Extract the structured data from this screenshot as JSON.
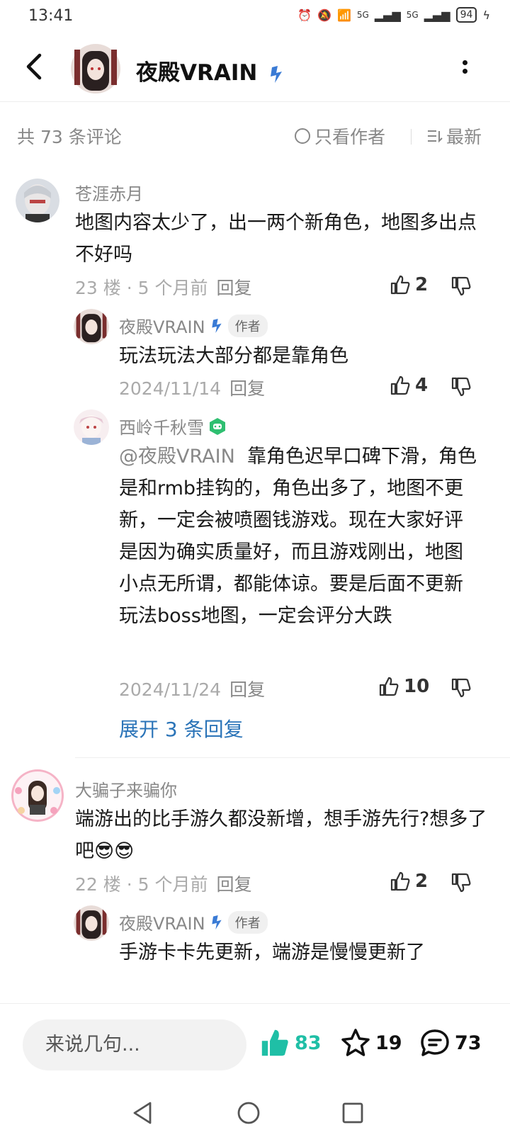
{
  "status": {
    "time": "13:41",
    "battery": "94",
    "net1": "5G",
    "net2": "5G"
  },
  "header": {
    "title": "夜殿VRAIN"
  },
  "filter": {
    "count": "共 73 条评论",
    "author_only": "只看作者",
    "sort": "最新"
  },
  "comments": [
    {
      "user": "苍涯赤月",
      "text": "地图内容太少了，出一两个新角色，地图多出点不好吗",
      "floor": "23 楼 · 5 个月前",
      "reply": "回复",
      "likes": "2",
      "replies": [
        {
          "user": "夜殿VRAIN",
          "tag": "作者",
          "text": "玩法玩法大部分都是靠角色",
          "time": "2024/11/14",
          "reply": "回复",
          "likes": "4"
        },
        {
          "user": "西岭千秋雪",
          "mention": "@夜殿VRAIN",
          "text": "靠角色迟早口碑下滑，角色是和rmb挂钩的，角色出多了，地图不更新，一定会被喷圈钱游戏。现在大家好评是因为确实质量好，而且游戏刚出，地图小点无所谓，都能体谅。要是后面不更新玩法boss地图，一定会评分大跌",
          "time": "2024/11/24",
          "reply": "回复",
          "likes": "10"
        }
      ],
      "expand": "展开 3 条回复"
    },
    {
      "user": "大骗子来骗你",
      "text": "端游出的比手游久都没新增，想手游先行?想多了吧😎😎",
      "floor": "22 楼 · 5 个月前",
      "reply": "回复",
      "likes": "2",
      "replies": [
        {
          "user": "夜殿VRAIN",
          "tag": "作者",
          "text": "手游卡卡先更新，端游是慢慢更新了"
        }
      ]
    }
  ],
  "bottom": {
    "input_placeholder": "来说几句...",
    "likes": "83",
    "favorites": "19",
    "comments": "73"
  },
  "colors": {
    "accent_teal": "#1fbfa6",
    "link_blue": "#2b74b8",
    "badge_blue": "#3a7bd5",
    "badge_green": "#2fbf71"
  }
}
